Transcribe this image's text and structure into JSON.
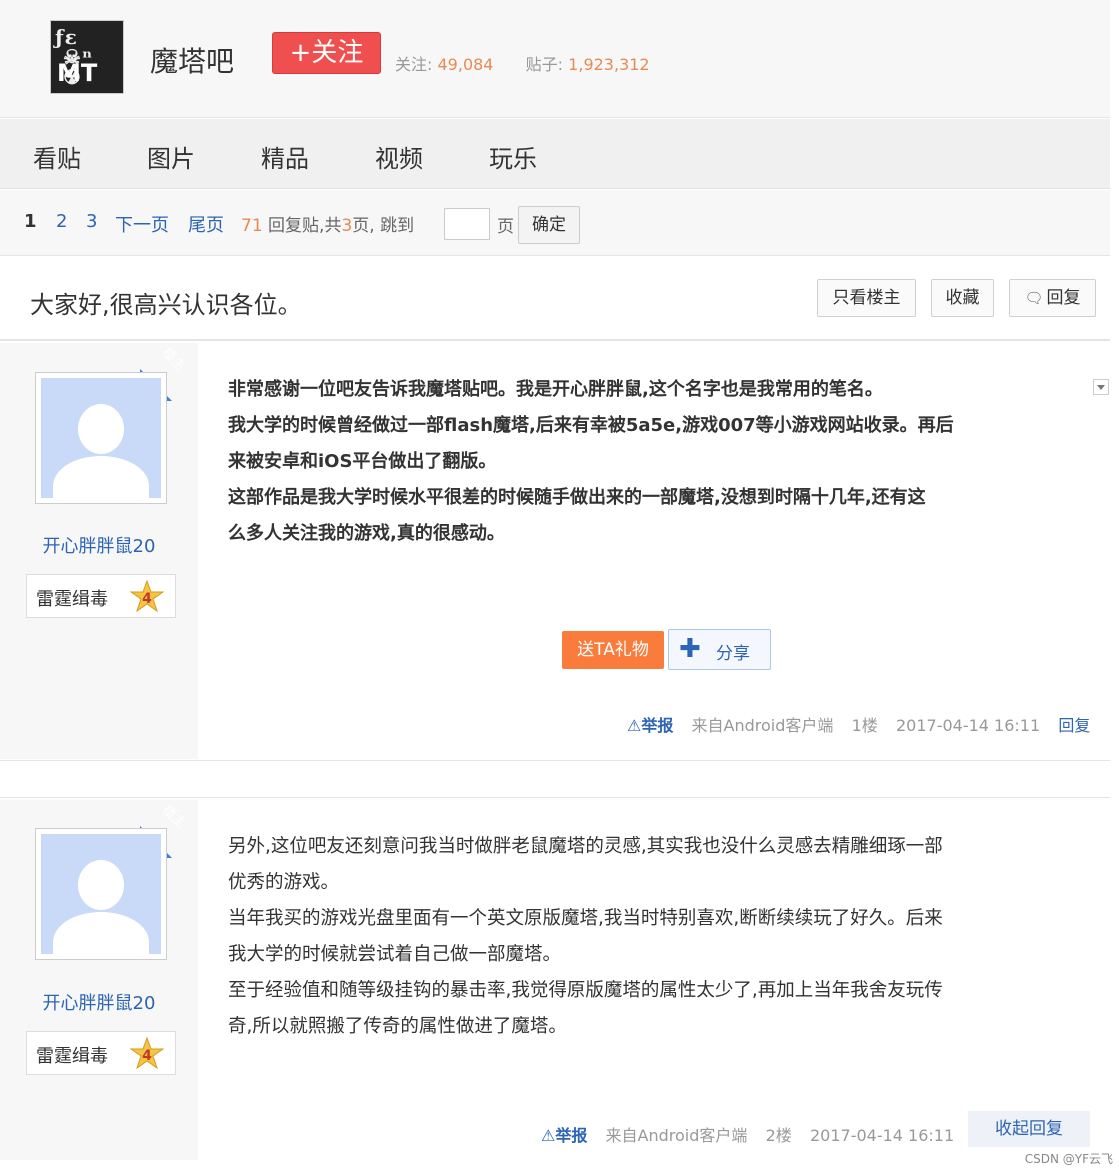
{
  "header": {
    "logo_text": "ΜΤ",
    "forum_name": "魔塔吧",
    "follow_label": "+关注",
    "stats": {
      "follow_label": "关注:",
      "follow_count": "49,084",
      "posts_label": "贴子:",
      "posts_count": "1,923,312"
    }
  },
  "nav": {
    "items": [
      "看贴",
      "图片",
      "精品",
      "视频",
      "玩乐"
    ]
  },
  "pager": {
    "pages": [
      "1",
      "2",
      "3"
    ],
    "next": "下一页",
    "last": "尾页",
    "reply_count": "71",
    "reply_text": "回复贴,共",
    "page_total": "3",
    "page_text": "页,",
    "jump_label": "跳到",
    "page_unit": "页",
    "confirm": "确定"
  },
  "thread": {
    "title": "大家好,很高兴认识各位。",
    "only_op": "只看楼主",
    "favorite": "收藏",
    "reply": "回复"
  },
  "posts": [
    {
      "badge_corner": "楼主",
      "username": "开心胖胖鼠20",
      "title_badge": "雷霆缉毒",
      "level": "4",
      "lines": [
        "非常感谢一位吧友告诉我魔塔贴吧。我是开心胖胖鼠,这个名字也是我常用的笔名。",
        "我大学的时候曾经做过一部flash魔塔,后来有幸被5a5e,游戏007等小游戏网站收录。再后",
        "来被安卓和iOS平台做出了翻版。",
        "这部作品是我大学时候水平很差的时候随手做出来的一部魔塔,没想到时隔十几年,还有这",
        "么多人关注我的游戏,真的很感动。"
      ],
      "gift": "送TA礼物",
      "share": "分享",
      "report": "举报",
      "client": "来自Android客户端",
      "floor": "1楼",
      "time": "2017-04-14 16:11",
      "reply": "回复"
    },
    {
      "badge_corner": "楼主",
      "username": "开心胖胖鼠20",
      "title_badge": "雷霆缉毒",
      "level": "4",
      "lines": [
        "另外,这位吧友还刻意问我当时做胖老鼠魔塔的灵感,其实我也没什么灵感去精雕细琢一部",
        "优秀的游戏。",
        "当年我买的游戏光盘里面有一个英文原版魔塔,我当时特别喜欢,断断续续玩了好久。后来",
        "我大学的时候就尝试着自己做一部魔塔。",
        "至于经验值和随等级挂钩的暴击率,我觉得原版魔塔的属性太少了,再加上当年我舍友玩传",
        "奇,所以就照搬了传奇的属性做进了魔塔。"
      ],
      "report": "举报",
      "client": "来自Android客户端",
      "floor": "2楼",
      "time": "2017-04-14 16:11",
      "collapse": "收起回复"
    }
  ],
  "watermark": "CSDN @YF云飞",
  "colors": {
    "link_blue": "#2d64b3",
    "follow_red": "#f04f4f",
    "gift_orange": "#f97c3c",
    "corner_blue": "#3b7ed8",
    "stat_orange": "#e88a54"
  }
}
